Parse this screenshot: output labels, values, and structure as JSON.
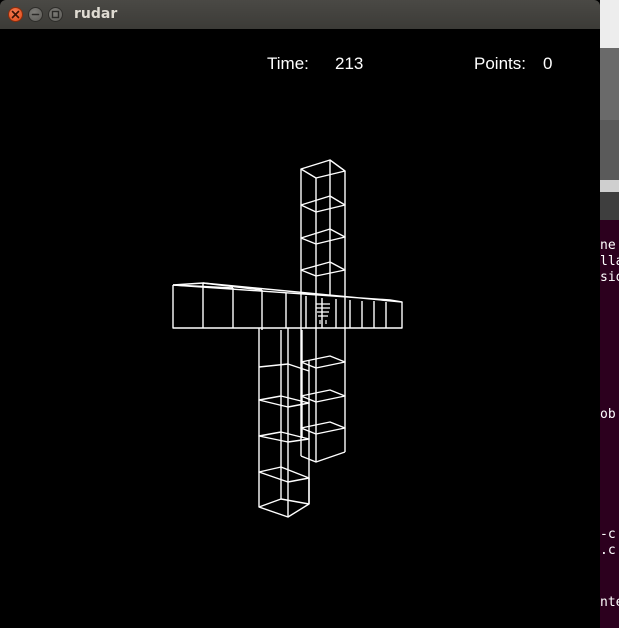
{
  "window": {
    "title": "rudar"
  },
  "hud": {
    "time_label": "Time:",
    "time_value": "213",
    "points_label": "Points:",
    "points_value": "0"
  },
  "background_terminal": {
    "lines": [
      "ne",
      "lla",
      "sio",
      "ob",
      "-c",
      ".c",
      "nte"
    ]
  },
  "colors": {
    "titlebar": "#3c3b37",
    "close_button": "#df4a16",
    "game_background": "#000000",
    "wireframe": "#ffffff",
    "terminal_background": "#2c001e"
  },
  "icons": {
    "close": "close-icon",
    "minimize": "minimize-icon",
    "maximize": "maximize-icon"
  }
}
